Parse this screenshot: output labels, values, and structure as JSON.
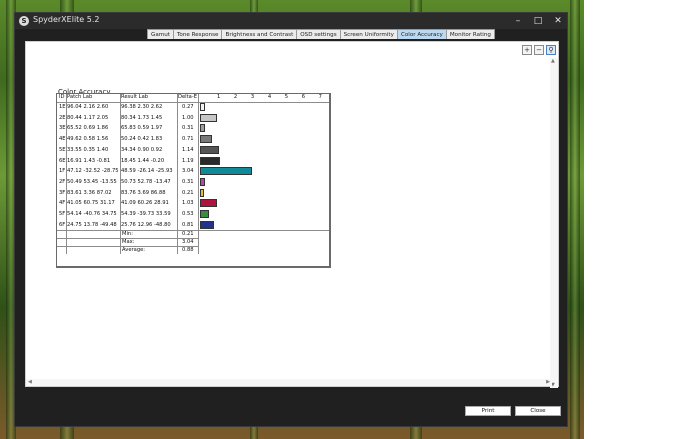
{
  "window": {
    "title": "SpyderXElite 5.2"
  },
  "tabs": [
    {
      "label": "Gamut"
    },
    {
      "label": "Tone Response"
    },
    {
      "label": "Brightness and Contrast"
    },
    {
      "label": "OSD settings"
    },
    {
      "label": "Screen Uniformity"
    },
    {
      "label": "Color Accuracy",
      "active": true
    },
    {
      "label": "Monitor Rating"
    }
  ],
  "report": {
    "title": "Color Accuracy",
    "headers": {
      "id": "ID",
      "patch": "Patch Lab",
      "result": "Result Lab",
      "delta": "Delta-E"
    },
    "axis_ticks": [
      "1",
      "2",
      "3",
      "4",
      "5",
      "6",
      "7"
    ],
    "axis_max": 7,
    "rows": [
      {
        "id": "1E",
        "patch": "96.04  2.16  2.60",
        "result": "96.38  2.30  2.62",
        "delta": "0.27",
        "value": 0.27,
        "color": "#f2f2f2"
      },
      {
        "id": "2E",
        "patch": "80.44  1.17  2.05",
        "result": "80.34  1.73  1.45",
        "delta": "1.00",
        "value": 1.0,
        "color": "#c6c6c6"
      },
      {
        "id": "3E",
        "patch": "65.52  0.69  1.86",
        "result": "65.83  0.59  1.97",
        "delta": "0.31",
        "value": 0.31,
        "color": "#9e9e9e"
      },
      {
        "id": "4E",
        "patch": "49.62  0.58  1.56",
        "result": "50.24  0.42  1.83",
        "delta": "0.71",
        "value": 0.71,
        "color": "#797979"
      },
      {
        "id": "5E",
        "patch": "33.55  0.35  1.40",
        "result": "34.34  0.90  0.92",
        "delta": "1.14",
        "value": 1.14,
        "color": "#545454"
      },
      {
        "id": "6E",
        "patch": "16.91  1.43 -0.81",
        "result": "18.45  1.44 -0.20",
        "delta": "1.19",
        "value": 1.19,
        "color": "#2a2a2a"
      },
      {
        "id": "1F",
        "patch": "47.12 -32.52 -28.75",
        "result": "48.59 -26.14 -25.93",
        "delta": "3.04",
        "value": 3.04,
        "color": "#0e8a99"
      },
      {
        "id": "2F",
        "patch": "50.49  53.45 -13.55",
        "result": "50.73  52.78 -13.47",
        "delta": "0.31",
        "value": 0.31,
        "color": "#b24a9e"
      },
      {
        "id": "3F",
        "patch": "83.61  3.36  87.02",
        "result": "83.76  3.69  86.88",
        "delta": "0.21",
        "value": 0.21,
        "color": "#e2c22e"
      },
      {
        "id": "4F",
        "patch": "41.05  60.75  31.17",
        "result": "41.09  60.26  28.91",
        "delta": "1.03",
        "value": 1.03,
        "color": "#b0143e"
      },
      {
        "id": "5F",
        "patch": "54.14 -40.76  34.75",
        "result": "54.39 -39.73  33.59",
        "delta": "0.53",
        "value": 0.53,
        "color": "#3a8c3e"
      },
      {
        "id": "6F",
        "patch": "24.75  13.78 -49.48",
        "result": "25.76  12.96 -48.80",
        "delta": "0.81",
        "value": 0.81,
        "color": "#23338c"
      }
    ],
    "summary": [
      {
        "label": "Min:",
        "value": "0.21"
      },
      {
        "label": "Max:",
        "value": "3.04"
      },
      {
        "label": "Average:",
        "value": "0.88"
      }
    ]
  },
  "buttons": {
    "print": "Print",
    "close": "Close"
  }
}
